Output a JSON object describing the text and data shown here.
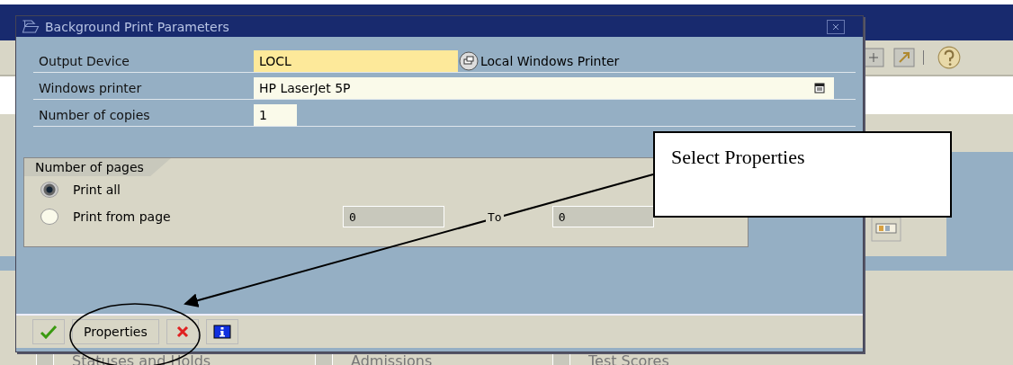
{
  "dialog": {
    "title": "Background Print Parameters",
    "fields": [
      {
        "label": "Output Device",
        "value": "LOCL",
        "kind": "required",
        "note": "Local Windows Printer"
      },
      {
        "label": "Windows printer",
        "value": "HP LaserJet 5P",
        "kind": "dropdown"
      },
      {
        "label": "Number of copies",
        "value": "1",
        "kind": "short"
      }
    ],
    "group": {
      "title": "Number of pages",
      "options": [
        {
          "label": "Print all",
          "selected": true
        },
        {
          "label": "Print from page",
          "selected": false
        }
      ],
      "from_value": "0",
      "to_label": "To",
      "to_value": "0"
    },
    "buttons": [
      {
        "kind": "confirm"
      },
      {
        "kind": "text",
        "label": "Properties"
      },
      {
        "kind": "cancel"
      },
      {
        "kind": "info"
      }
    ]
  },
  "background": {
    "checkboxes": [
      {
        "label": "Statuses and Holds",
        "checked": false
      },
      {
        "label": "Admissions",
        "checked": false
      },
      {
        "label": "Test Scores",
        "checked": false
      }
    ]
  },
  "callout": {
    "text": "Select Properties"
  }
}
